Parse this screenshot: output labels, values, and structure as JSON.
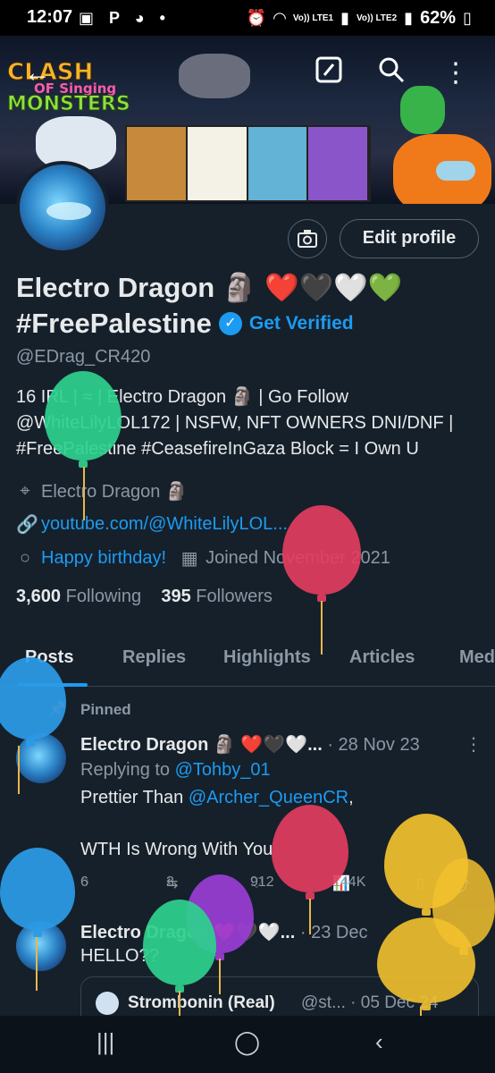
{
  "status_bar": {
    "time": "12:07",
    "left_icons": [
      "gallery-icon",
      "p-icon",
      "controller-icon",
      "dot-icon"
    ],
    "network1": "Vo)) LTE1",
    "network2": "Vo)) LTE2",
    "battery": "62%"
  },
  "banner": {
    "logo_line1": "CLASH",
    "logo_line2": "OF Singing",
    "logo_line3": "MONSTERS"
  },
  "profile": {
    "edit_label": "Edit profile",
    "name_line1": "Electro Dragon 🗿 ❤️🖤🤍💚",
    "name_line2": "#FreePalestine",
    "get_verified": "Get Verified",
    "handle": "@EDrag_CR420",
    "bio_line1": "16 IRL | ≈ | Electro Dragon 🗿 | Go Follow",
    "bio_line2": "@WhiteLilyLOL172 | NSFW, NFT OWNERS DNI/DNF |",
    "bio_line3": "#FreePalestine #CeasefireInGaza Block = I Own U",
    "location": "Electro Dragon 🗿",
    "link": "youtube.com/@WhiteLilyLOL...",
    "birthday": "Happy birthday!",
    "joined": "Joined November 2021",
    "following_count": "3,600",
    "following_label": "Following",
    "followers_count": "395",
    "followers_label": "Followers"
  },
  "tabs": [
    "Posts",
    "Replies",
    "Highlights",
    "Articles",
    "Med"
  ],
  "pinned_label": "Pinned",
  "tweet1": {
    "name": "Electro Dragon 🗿 ❤️🖤🤍...",
    "date": "· 28 Nov 23",
    "replying_prefix": "Replying to ",
    "replying_handle": "@Tohby_01",
    "line1_prefix": "Prettier Than ",
    "line1_handle": "@Archer_QueenCR",
    "line1_suffix": ",",
    "line2": "WTH Is Wrong With You",
    "replies": "6",
    "retweets": "3",
    "likes": "912",
    "views": "144K"
  },
  "tweet2": {
    "name": "Electro Dragon ❤️🖤🤍...",
    "date": "· 23 Dec",
    "text": "HELLO??",
    "quote_name": "Strombonin (Real)",
    "quote_rest": "@st... · 05 Dec 24"
  },
  "colors": {
    "background": "#15202b",
    "accent": "#1d9bf0",
    "muted": "#8b98a5",
    "balloon_green": "#2ed18e",
    "balloon_red": "#e23d5f",
    "balloon_blue": "#2b9ce8",
    "balloon_yellow": "#f2c12e",
    "balloon_purple": "#9b3dd6"
  }
}
